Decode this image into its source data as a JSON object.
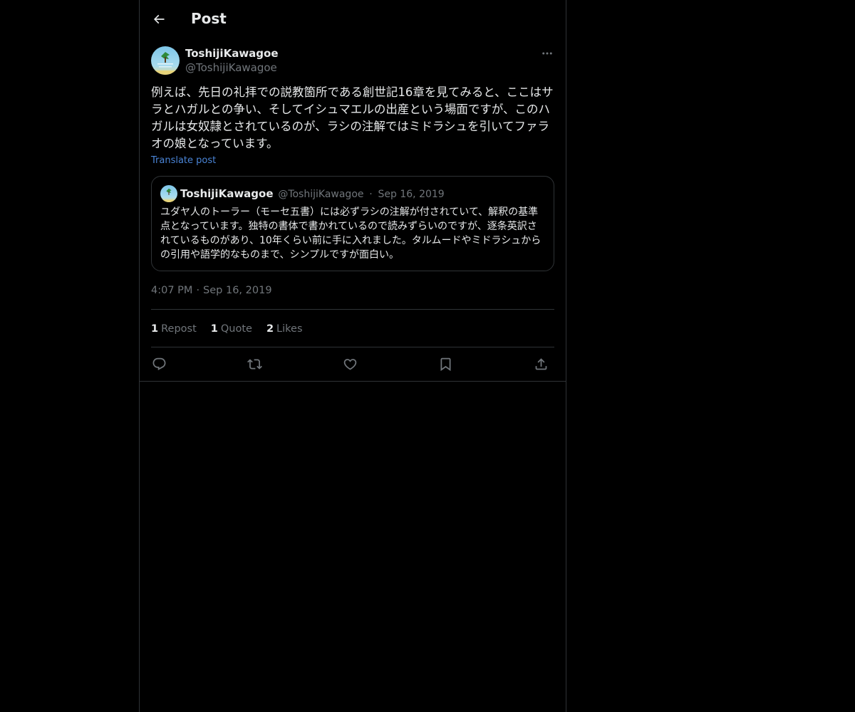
{
  "topbar": {
    "title": "Post",
    "back_icon": "arrow-left-icon"
  },
  "post": {
    "author": {
      "display_name": "ToshijiKawagoe",
      "handle": "@ToshijiKawagoe"
    },
    "more_icon": "more-horizontal-icon",
    "text": "例えば、先日の礼拝での説教箇所である創世記16章を見てみると、ここはサラとハガルとの争い、そしてイシュマエルの出産という場面ですが、このハガルは女奴隷とされているのが、ラシの注解ではミドラシュを引いてファラオの娘となっています。",
    "translate_label": "Translate post",
    "quoted": {
      "display_name": "ToshijiKawagoe",
      "handle": "@ToshijiKawagoe",
      "separator": "·",
      "date": "Sep 16, 2019",
      "text": "ユダヤ人のトーラー（モーセ五書）には必ずラシの注解が付されていて、解釈の基準点となっています。独特の書体で書かれているので読みずらいのですが、逐条英訳されているものがあり、10年くらい前に手に入れました。タルムードやミドラシュからの引用や語学的なものまで、シンプルですが面白い。"
    },
    "time": "4:07 PM",
    "time_separator": "·",
    "date": "Sep 16, 2019",
    "stats": {
      "reposts_count": "1",
      "reposts_label": "Repost",
      "quotes_count": "1",
      "quotes_label": "Quote",
      "likes_count": "2",
      "likes_label": "Likes"
    },
    "actions": {
      "reply_icon": "reply-icon",
      "repost_icon": "repost-icon",
      "like_icon": "heart-icon",
      "bookmark_icon": "bookmark-icon",
      "share_icon": "share-icon"
    }
  },
  "colors": {
    "background": "#000000",
    "text_primary": "#e7e9ea",
    "text_secondary": "#71767b",
    "border": "#2f3336",
    "link": "#4a84d6"
  }
}
